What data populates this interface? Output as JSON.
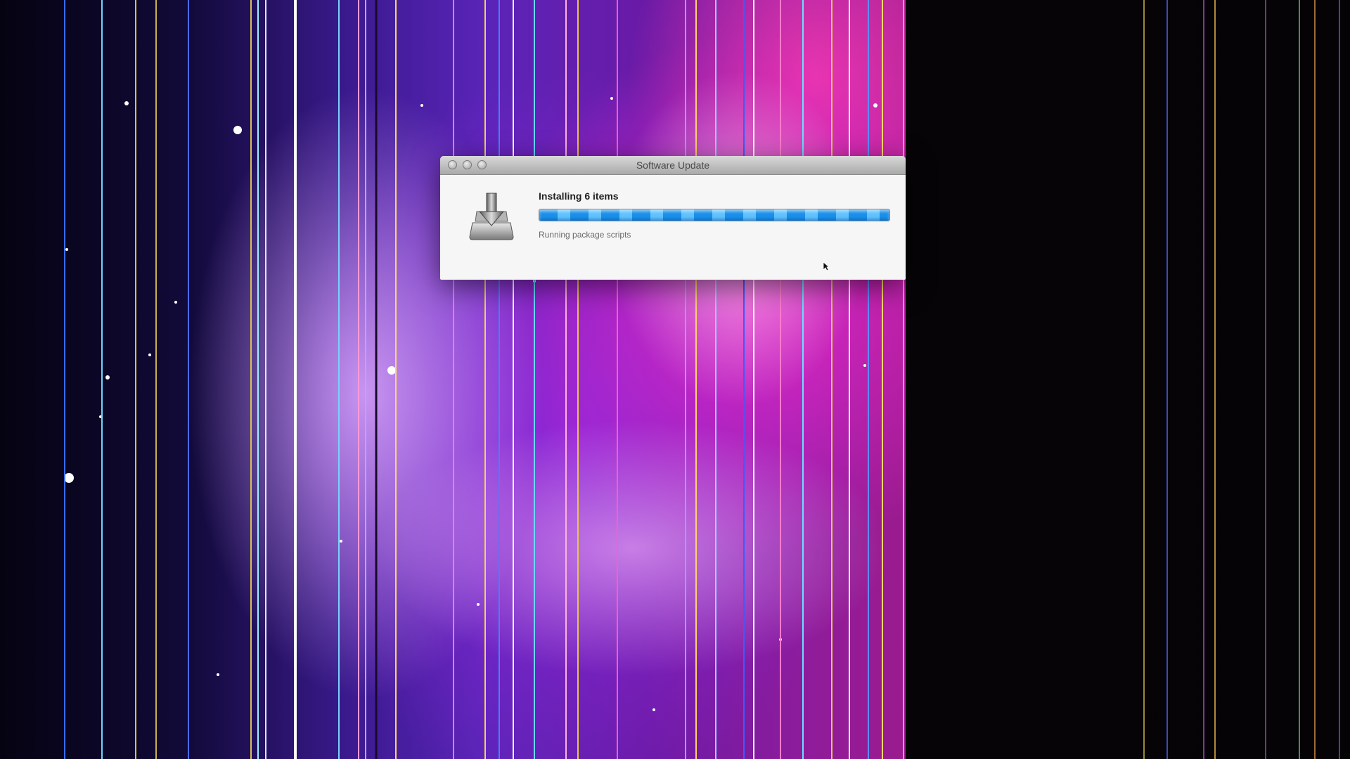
{
  "window": {
    "title": "Software Update",
    "heading": "Installing 6 items",
    "status": "Running package scripts",
    "progress": 1.0
  },
  "colors": {
    "progress_accent": "#1a8fe8",
    "window_background": "#f6f6f6"
  },
  "icons": {
    "installer": "installer-disk-icon",
    "cursor": "mouse-pointer-icon"
  }
}
